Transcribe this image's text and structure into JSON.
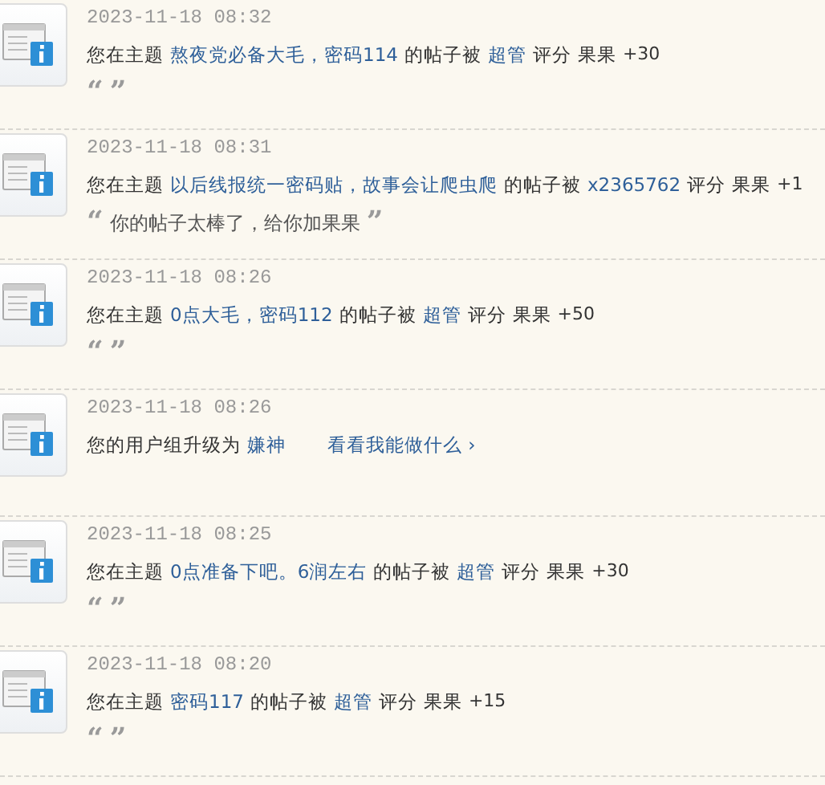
{
  "notices": [
    {
      "time": "2023-11-18 08:32",
      "parts": [
        {
          "kind": "text",
          "text": "您在主题"
        },
        {
          "kind": "topic",
          "text": "熬夜党必备大毛，密码114"
        },
        {
          "kind": "text",
          "text": "的帖子被"
        },
        {
          "kind": "user",
          "text": "超管"
        },
        {
          "kind": "text",
          "text": "评分"
        },
        {
          "kind": "text",
          "text": "果果"
        },
        {
          "kind": "score",
          "text": "+30"
        }
      ],
      "quote": {
        "open": "“",
        "close": "”"
      }
    },
    {
      "time": "2023-11-18 08:31",
      "parts": [
        {
          "kind": "text",
          "text": "您在主题"
        },
        {
          "kind": "topic",
          "text": "以后线报统一密码贴，故事会让爬虫爬"
        },
        {
          "kind": "text",
          "text": "的帖子被"
        },
        {
          "kind": "user",
          "text": "x2365762"
        },
        {
          "kind": "text",
          "text": "评分"
        },
        {
          "kind": "text",
          "text": "果果"
        },
        {
          "kind": "score",
          "text": "+1"
        }
      ],
      "quote": {
        "open": "“",
        "text": "你的帖子太棒了，给你加果果",
        "close": "”"
      }
    },
    {
      "time": "2023-11-18 08:26",
      "parts": [
        {
          "kind": "text",
          "text": "您在主题"
        },
        {
          "kind": "topic",
          "text": "0点大毛，密码112"
        },
        {
          "kind": "text",
          "text": "的帖子被"
        },
        {
          "kind": "user",
          "text": "超管"
        },
        {
          "kind": "text",
          "text": "评分"
        },
        {
          "kind": "text",
          "text": "果果"
        },
        {
          "kind": "score",
          "text": "+50"
        }
      ],
      "quote": {
        "open": "“",
        "close": "”"
      }
    },
    {
      "time": "2023-11-18 08:26",
      "parts": [
        {
          "kind": "text",
          "text": "您的用户组升级为"
        },
        {
          "kind": "group",
          "text": "嫌神"
        },
        {
          "kind": "action",
          "text": "看看我能做什么 ›"
        }
      ]
    },
    {
      "time": "2023-11-18 08:25",
      "parts": [
        {
          "kind": "text",
          "text": "您在主题"
        },
        {
          "kind": "topic",
          "text": "0点准备下吧。6润左右"
        },
        {
          "kind": "text",
          "text": "的帖子被"
        },
        {
          "kind": "user",
          "text": "超管"
        },
        {
          "kind": "text",
          "text": "评分"
        },
        {
          "kind": "text",
          "text": "果果"
        },
        {
          "kind": "score",
          "text": "+30"
        }
      ],
      "quote": {
        "open": "“",
        "close": "”"
      }
    },
    {
      "time": "2023-11-18 08:20",
      "parts": [
        {
          "kind": "text",
          "text": "您在主题"
        },
        {
          "kind": "topic",
          "text": "密码117"
        },
        {
          "kind": "text",
          "text": "的帖子被"
        },
        {
          "kind": "user",
          "text": "超管"
        },
        {
          "kind": "text",
          "text": "评分"
        },
        {
          "kind": "text",
          "text": "果果"
        },
        {
          "kind": "score",
          "text": "+15"
        }
      ],
      "quote": {
        "open": "“",
        "close": "”"
      }
    }
  ]
}
